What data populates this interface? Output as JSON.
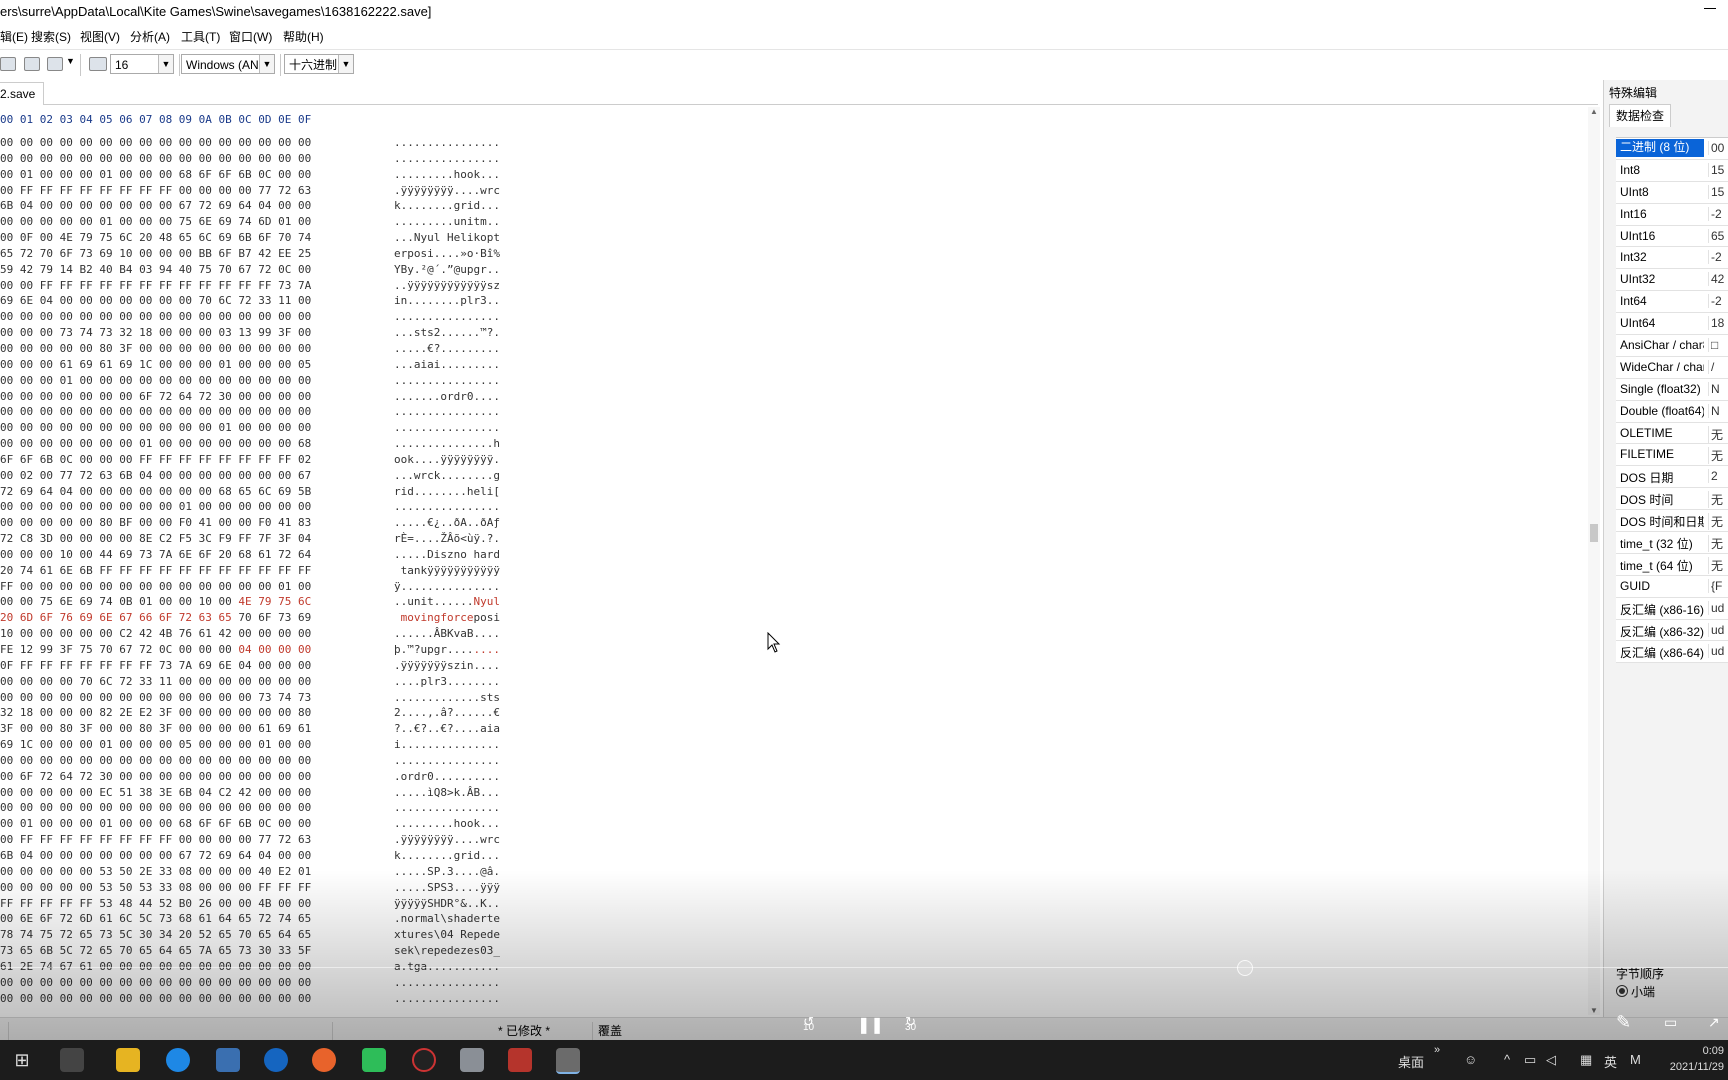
{
  "window": {
    "title": "ers\\surre\\AppData\\Local\\Kite Games\\Swine\\savegames\\1638162222.save]"
  },
  "menu": [
    "辑(E)",
    "搜索(S)",
    "视图(V)",
    "分析(A)",
    "工具(T)",
    "窗口(W)",
    "帮助(H)"
  ],
  "toolbar": {
    "bytes_per_row": "16",
    "encoding": "Windows (AN",
    "number_base": "十六进制"
  },
  "tabs": [
    {
      "label": "2.save"
    }
  ],
  "hex_header": "00 01 02 03 04 05 06 07 08 09 0A 0B 0C 0D 0E 0F",
  "rows": [
    {
      "hex": "00 00 00 00 00 00 00 00 00 00 00 00 00 00 00 00",
      "ascii": "................"
    },
    {
      "hex": "00 00 00 00 00 00 00 00 00 00 00 00 00 00 00 00",
      "ascii": "................"
    },
    {
      "hex": "00 01 00 00 00 01 00 00 00 68 6F 6F 6B 0C 00 00",
      "ascii": ".........hook..."
    },
    {
      "hex": "00 FF FF FF FF FF FF FF FF 00 00 00 00 77 72 63",
      "ascii": ".ÿÿÿÿÿÿÿÿ....wrc"
    },
    {
      "hex": "6B 04 00 00 00 00 00 00 00 67 72 69 64 04 00 00",
      "ascii": "k........grid..."
    },
    {
      "hex": "00 00 00 00 00 01 00 00 00 75 6E 69 74 6D 01 00",
      "ascii": ".........unitm.."
    },
    {
      "hex": "00 0F 00 4E 79 75 6C 20 48 65 6C 69 6B 6F 70 74",
      "ascii": "...Nyul Helikopt"
    },
    {
      "hex": "65 72 70 6F 73 69 10 00 00 00 BB 6F B7 42 EE 25",
      "ascii": "erposi....»o·Bî%"
    },
    {
      "hex": "59 42 79 14 B2 40 B4 03 94 40 75 70 67 72 0C 00",
      "ascii": "YBy.²@´.”@upgr.."
    },
    {
      "hex": "00 00 FF FF FF FF FF FF FF FF FF FF FF FF 73 7A",
      "ascii": "..ÿÿÿÿÿÿÿÿÿÿÿÿsz"
    },
    {
      "hex": "69 6E 04 00 00 00 00 00 00 00 70 6C 72 33 11 00",
      "ascii": "in........plr3.."
    },
    {
      "hex": "00 00 00 00 00 00 00 00 00 00 00 00 00 00 00 00",
      "ascii": "................"
    },
    {
      "hex": "00 00 00 73 74 73 32 18 00 00 00 03 13 99 3F 00",
      "ascii": "...sts2......™?."
    },
    {
      "hex": "00 00 00 00 00 80 3F 00 00 00 00 00 00 00 00 00",
      "ascii": ".....€?........."
    },
    {
      "hex": "00 00 00 61 69 61 69 1C 00 00 00 01 00 00 00 05",
      "ascii": "...aiai........."
    },
    {
      "hex": "00 00 00 01 00 00 00 00 00 00 00 00 00 00 00 00",
      "ascii": "................"
    },
    {
      "hex": "00 00 00 00 00 00 00 6F 72 64 72 30 00 00 00 00",
      "ascii": ".......ordr0...."
    },
    {
      "hex": "00 00 00 00 00 00 00 00 00 00 00 00 00 00 00 00",
      "ascii": "................"
    },
    {
      "hex": "00 00 00 00 00 00 00 00 00 00 00 01 00 00 00 00",
      "ascii": "................"
    },
    {
      "hex": "00 00 00 00 00 00 00 01 00 00 00 00 00 00 00 68",
      "ascii": "...............h"
    },
    {
      "hex": "6F 6F 6B 0C 00 00 00 FF FF FF FF FF FF FF FF 02",
      "ascii": "ook....ÿÿÿÿÿÿÿÿ."
    },
    {
      "hex": "00 02 00 77 72 63 6B 04 00 00 00 00 00 00 00 67",
      "ascii": "...wrck........g"
    },
    {
      "hex": "72 69 64 04 00 00 00 00 00 00 00 68 65 6C 69 5B",
      "ascii": "rid........heli["
    },
    {
      "hex": "00 00 00 00 00 00 00 00 00 01 00 00 00 00 00 00",
      "ascii": "................"
    },
    {
      "hex": "00 00 00 00 00 80 BF 00 00 F0 41 00 00 F0 41 83",
      "ascii": ".....€¿..ðA..ðAƒ"
    },
    {
      "hex": "72 C8 3D 00 00 00 00 8E C2 F5 3C F9 FF 7F 3F 04",
      "ascii": "rÈ=....ŽÂõ<ùÿ.?."
    },
    {
      "hex": "00 00 00 10 00 44 69 73 7A 6E 6F 20 68 61 72 64",
      "ascii": ".....Diszno hard"
    },
    {
      "hex": "20 74 61 6E 6B FF FF FF FF FF FF FF FF FF FF FF",
      "ascii": " tankÿÿÿÿÿÿÿÿÿÿÿ"
    },
    {
      "hex": "FF 00 00 00 00 00 00 00 00 00 00 00 00 00 01 00",
      "ascii": "ÿ..............."
    },
    {
      "hex": "00 00 75 6E 69 74 0B 01 00 00 10 00 |4E 79 75 6C",
      "ascii": "..unit......|Nyul"
    },
    {
      "hex": "|20 6D 6F 76 69 6E 67 66 6F 72 63 65| 70 6F 73 69",
      "ascii": "| movingforce|posi"
    },
    {
      "hex": "10 00 00 00 00 00 C2 42 4B 76 61 42 00 00 00 00",
      "ascii": "......ÂBKvaB...."
    },
    {
      "hex": "FE 12 99 3F 75 70 67 72 0C 00 00 00 |04 00 00 00",
      "ascii": "þ.™?upgr....|...."
    },
    {
      "hex": "0F FF FF FF FF FF FF FF 73 7A 69 6E 04 00 00 00",
      "ascii": ".ÿÿÿÿÿÿÿszin...."
    },
    {
      "hex": "00 00 00 00 70 6C 72 33 11 00 00 00 00 00 00 00",
      "ascii": "....plr3........"
    },
    {
      "hex": "00 00 00 00 00 00 00 00 00 00 00 00 00 73 74 73",
      "ascii": ".............sts"
    },
    {
      "hex": "32 18 00 00 00 82 2E E2 3F 00 00 00 00 00 00 80",
      "ascii": "2....,.â?......€"
    },
    {
      "hex": "3F 00 00 80 3F 00 00 80 3F 00 00 00 00 61 69 61",
      "ascii": "?..€?..€?....aia"
    },
    {
      "hex": "69 1C 00 00 00 01 00 00 00 05 00 00 00 01 00 00",
      "ascii": "i..............."
    },
    {
      "hex": "00 00 00 00 00 00 00 00 00 00 00 00 00 00 00 00",
      "ascii": "................"
    },
    {
      "hex": "00 6F 72 64 72 30 00 00 00 00 00 00 00 00 00 00",
      "ascii": ".ordr0.........."
    },
    {
      "hex": "00 00 00 00 00 EC 51 38 3E 6B 04 C2 42 00 00 00",
      "ascii": ".....ìQ8>k.ÂB..."
    },
    {
      "hex": "00 00 00 00 00 00 00 00 00 00 00 00 00 00 00 00",
      "ascii": "................"
    },
    {
      "hex": "00 01 00 00 00 01 00 00 00 68 6F 6F 6B 0C 00 00",
      "ascii": ".........hook..."
    },
    {
      "hex": "00 FF FF FF FF FF FF FF FF 00 00 00 00 77 72 63",
      "ascii": ".ÿÿÿÿÿÿÿÿ....wrc"
    },
    {
      "hex": "6B 04 00 00 00 00 00 00 00 67 72 69 64 04 00 00",
      "ascii": "k........grid..."
    },
    {
      "hex": "00 00 00 00 00 53 50 2E 33 08 00 00 00 40 E2 01",
      "ascii": ".....SP.3....@â."
    },
    {
      "hex": "00 00 00 00 00 53 50 53 33 08 00 00 00 FF FF FF",
      "ascii": ".....SPS3....ÿÿÿ"
    },
    {
      "hex": "FF FF FF FF FF 53 48 44 52 B0 26 00 00 4B 00 00",
      "ascii": "ÿÿÿÿÿSHDR°&..K.."
    },
    {
      "hex": "00 6E 6F 72 6D 61 6C 5C 73 68 61 64 65 72 74 65",
      "ascii": ".normal\\shaderte"
    },
    {
      "hex": "78 74 75 72 65 73 5C 30 34 20 52 65 70 65 64 65",
      "ascii": "xtures\\04 Repede"
    },
    {
      "hex": "73 65 6B 5C 72 65 70 65 64 65 7A 65 73 30 33 5F",
      "ascii": "sek\\repedezes03_"
    },
    {
      "hex": "61 2E 74 67 61 00 00 00 00 00 00 00 00 00 00 00",
      "ascii": "a.tga..........."
    },
    {
      "hex": "00 00 00 00 00 00 00 00 00 00 00 00 00 00 00 00",
      "ascii": "................"
    },
    {
      "hex": "00 00 00 00 00 00 00 00 00 00 00 00 00 00 00 00",
      "ascii": "................"
    }
  ],
  "panel": {
    "title": "特殊编辑",
    "tab": "数据检查",
    "inspector": [
      {
        "k": "二进制 (8 位)",
        "v": "00"
      },
      {
        "k": "Int8",
        "v": "15"
      },
      {
        "k": "UInt8",
        "v": "15"
      },
      {
        "k": "Int16",
        "v": "-2"
      },
      {
        "k": "UInt16",
        "v": "65"
      },
      {
        "k": "Int32",
        "v": "-2"
      },
      {
        "k": "UInt32",
        "v": "42"
      },
      {
        "k": "Int64",
        "v": "-2"
      },
      {
        "k": "UInt64",
        "v": "18"
      },
      {
        "k": "AnsiChar / char8",
        "v": "□"
      },
      {
        "k": "WideChar / char",
        "v": "/"
      },
      {
        "k": "Single (float32)",
        "v": "N"
      },
      {
        "k": "Double (float64)",
        "v": "N"
      },
      {
        "k": "OLETIME",
        "v": "无"
      },
      {
        "k": "FILETIME",
        "v": "无"
      },
      {
        "k": "DOS 日期",
        "v": "2"
      },
      {
        "k": "DOS 时间",
        "v": "无"
      },
      {
        "k": "DOS 时间和日期",
        "v": "无"
      },
      {
        "k": "time_t (32 位)",
        "v": "无"
      },
      {
        "k": "time_t (64 位)",
        "v": "无"
      },
      {
        "k": "GUID",
        "v": "{F"
      },
      {
        "k": "反汇编 (x86-16)",
        "v": "ud"
      },
      {
        "k": "反汇编 (x86-32)",
        "v": "ud"
      },
      {
        "k": "反汇编 (x86-64)",
        "v": "ud"
      }
    ],
    "byte_order_label": "字节顺序",
    "little_endian": "小端"
  },
  "status": {
    "modified": "* 已修改 *",
    "mode": "覆盖"
  },
  "player": {
    "back": "10",
    "fwd": "30"
  },
  "taskbar": {
    "desktop": "桌面",
    "ime": "英",
    "time": "0:09",
    "date": "2021/11/29"
  }
}
